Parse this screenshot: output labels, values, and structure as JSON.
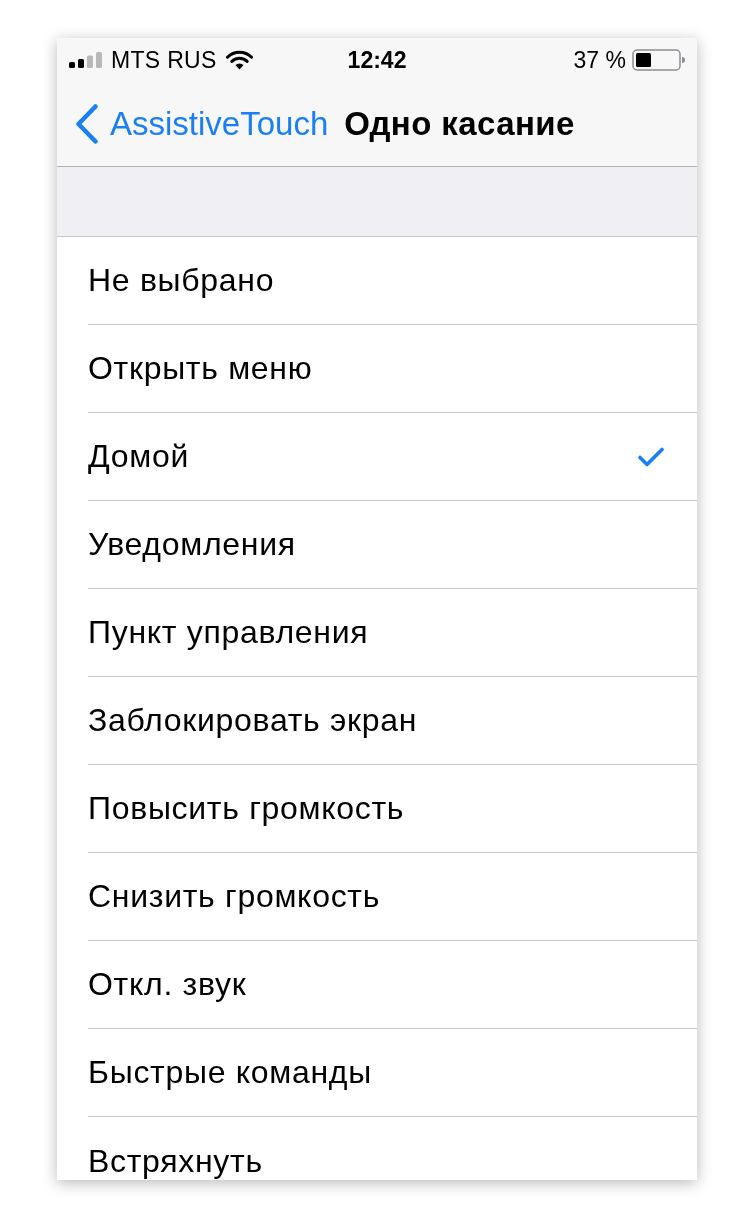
{
  "status_bar": {
    "carrier": "MTS RUS",
    "time": "12:42",
    "battery_percent": "37 %"
  },
  "nav_bar": {
    "back_label": "AssistiveTouch",
    "title": "Одно касание"
  },
  "options": [
    {
      "label": "Не выбрано",
      "selected": false
    },
    {
      "label": "Открыть меню",
      "selected": false
    },
    {
      "label": "Домой",
      "selected": true
    },
    {
      "label": "Уведомления",
      "selected": false
    },
    {
      "label": "Пункт управления",
      "selected": false
    },
    {
      "label": "Заблокировать экран",
      "selected": false
    },
    {
      "label": "Повысить громкость",
      "selected": false
    },
    {
      "label": "Снизить громкость",
      "selected": false
    },
    {
      "label": "Откл. звук",
      "selected": false
    },
    {
      "label": "Быстрые команды",
      "selected": false
    },
    {
      "label": "Встряхнуть",
      "selected": false
    }
  ]
}
